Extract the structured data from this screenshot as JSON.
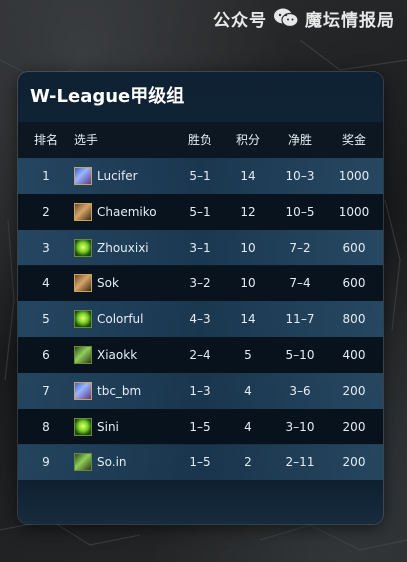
{
  "watermark": {
    "text": "公众号 · 魔坛情报局",
    "label": "公众号",
    "name": "魔坛情报局"
  },
  "table": {
    "title": "W-League甲级组",
    "headers": {
      "rank": "排名",
      "player": "选手",
      "wl": "胜负",
      "points": "积分",
      "net": "净胜",
      "prize": "奖金"
    },
    "rows": [
      {
        "rank": "1",
        "player": "Lucifer",
        "race": "human",
        "wl": "5–1",
        "points": "14",
        "net": "10–3",
        "prize": "1000"
      },
      {
        "rank": "2",
        "player": "Chaemiko",
        "race": "orc",
        "wl": "5–1",
        "points": "12",
        "net": "10–5",
        "prize": "1000"
      },
      {
        "rank": "3",
        "player": "Zhouxixi",
        "race": "nightelf",
        "wl": "3–1",
        "points": "10",
        "net": "7–2",
        "prize": "600"
      },
      {
        "rank": "4",
        "player": "Sok",
        "race": "orc",
        "wl": "3–2",
        "points": "10",
        "net": "7–4",
        "prize": "600"
      },
      {
        "rank": "5",
        "player": "Colorful",
        "race": "nightelf",
        "wl": "4–3",
        "points": "14",
        "net": "11–7",
        "prize": "800"
      },
      {
        "rank": "6",
        "player": "Xiaokk",
        "race": "undead",
        "wl": "2–4",
        "points": "5",
        "net": "5–10",
        "prize": "400"
      },
      {
        "rank": "7",
        "player": "tbc_bm",
        "race": "human",
        "wl": "1–3",
        "points": "4",
        "net": "3–6",
        "prize": "200"
      },
      {
        "rank": "8",
        "player": "Sini",
        "race": "nightelf",
        "wl": "1–5",
        "points": "4",
        "net": "3–10",
        "prize": "200"
      },
      {
        "rank": "9",
        "player": "So.in",
        "race": "undead",
        "wl": "1–5",
        "points": "2",
        "net": "2–11",
        "prize": "200"
      }
    ]
  }
}
